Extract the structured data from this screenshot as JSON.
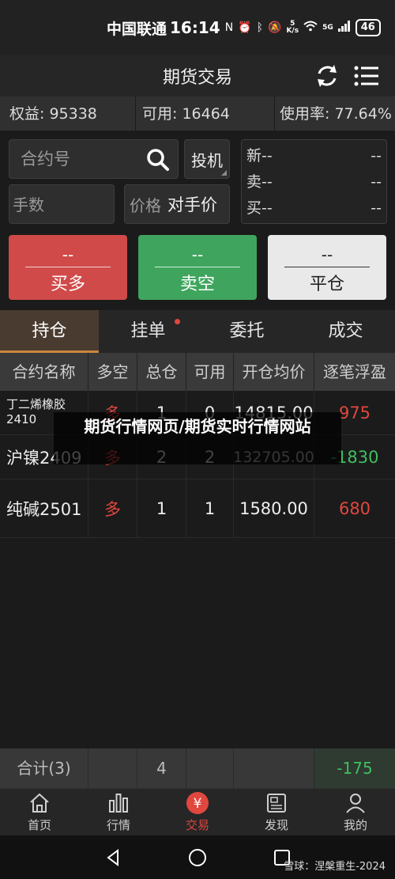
{
  "status_bar": {
    "carrier": "中国联通",
    "time": "16:14",
    "net_speed_top": "5",
    "net_speed_unit": "K/s",
    "network": "5G",
    "battery": "46"
  },
  "header": {
    "title": "期货交易"
  },
  "account": {
    "equity": "权益: 95338",
    "available": "可用: 16464",
    "usage": "使用率: 77.64%"
  },
  "order_form": {
    "contract_placeholder": "合约号",
    "speculate_label": "投机",
    "quantity_placeholder": "手数",
    "price_label": "价格",
    "price_value": "对手价",
    "quote": [
      {
        "label": "新",
        "left": "--",
        "right": "--"
      },
      {
        "label": "卖",
        "left": "--",
        "right": "--"
      },
      {
        "label": "买",
        "left": "--",
        "right": "--"
      }
    ],
    "buttons": {
      "buy": {
        "price": "--",
        "label": "买多"
      },
      "sell": {
        "price": "--",
        "label": "卖空"
      },
      "close": {
        "price": "--",
        "label": "平仓"
      }
    }
  },
  "tabs": [
    "持仓",
    "挂单",
    "委托",
    "成交"
  ],
  "positions": {
    "headers": [
      "合约名称",
      "多空",
      "总仓",
      "可用",
      "开仓均价",
      "逐笔浮盈"
    ],
    "rows": [
      {
        "name": "丁二烯橡胶2410",
        "direction": "多",
        "total": "1",
        "available": "0",
        "avg_price": "14815.00",
        "pnl": "975"
      },
      {
        "name": "沪镍2409",
        "direction": "多",
        "total": "2",
        "available": "2",
        "avg_price": "132705.00",
        "pnl": "-1830"
      },
      {
        "name": "纯碱2501",
        "direction": "多",
        "total": "1",
        "available": "1",
        "avg_price": "1580.00",
        "pnl": "680"
      }
    ],
    "summary": {
      "label": "合计(3)",
      "total": "4",
      "pnl": "-175"
    }
  },
  "overlay_text": "期货行情网页/期货实时行情网站",
  "bottom_nav": [
    {
      "label": "首页",
      "icon": "home-icon"
    },
    {
      "label": "行情",
      "icon": "chart-icon"
    },
    {
      "label": "交易",
      "icon": "yen-icon"
    },
    {
      "label": "发现",
      "icon": "news-icon"
    },
    {
      "label": "我的",
      "icon": "user-icon"
    }
  ],
  "credit": "雪球：涅槃重生-2024",
  "colors": {
    "buy": "#d04a49",
    "sell": "#3fa55e",
    "accent": "#c7873f",
    "profit": "#e0473f",
    "loss": "#3fbf5f"
  }
}
